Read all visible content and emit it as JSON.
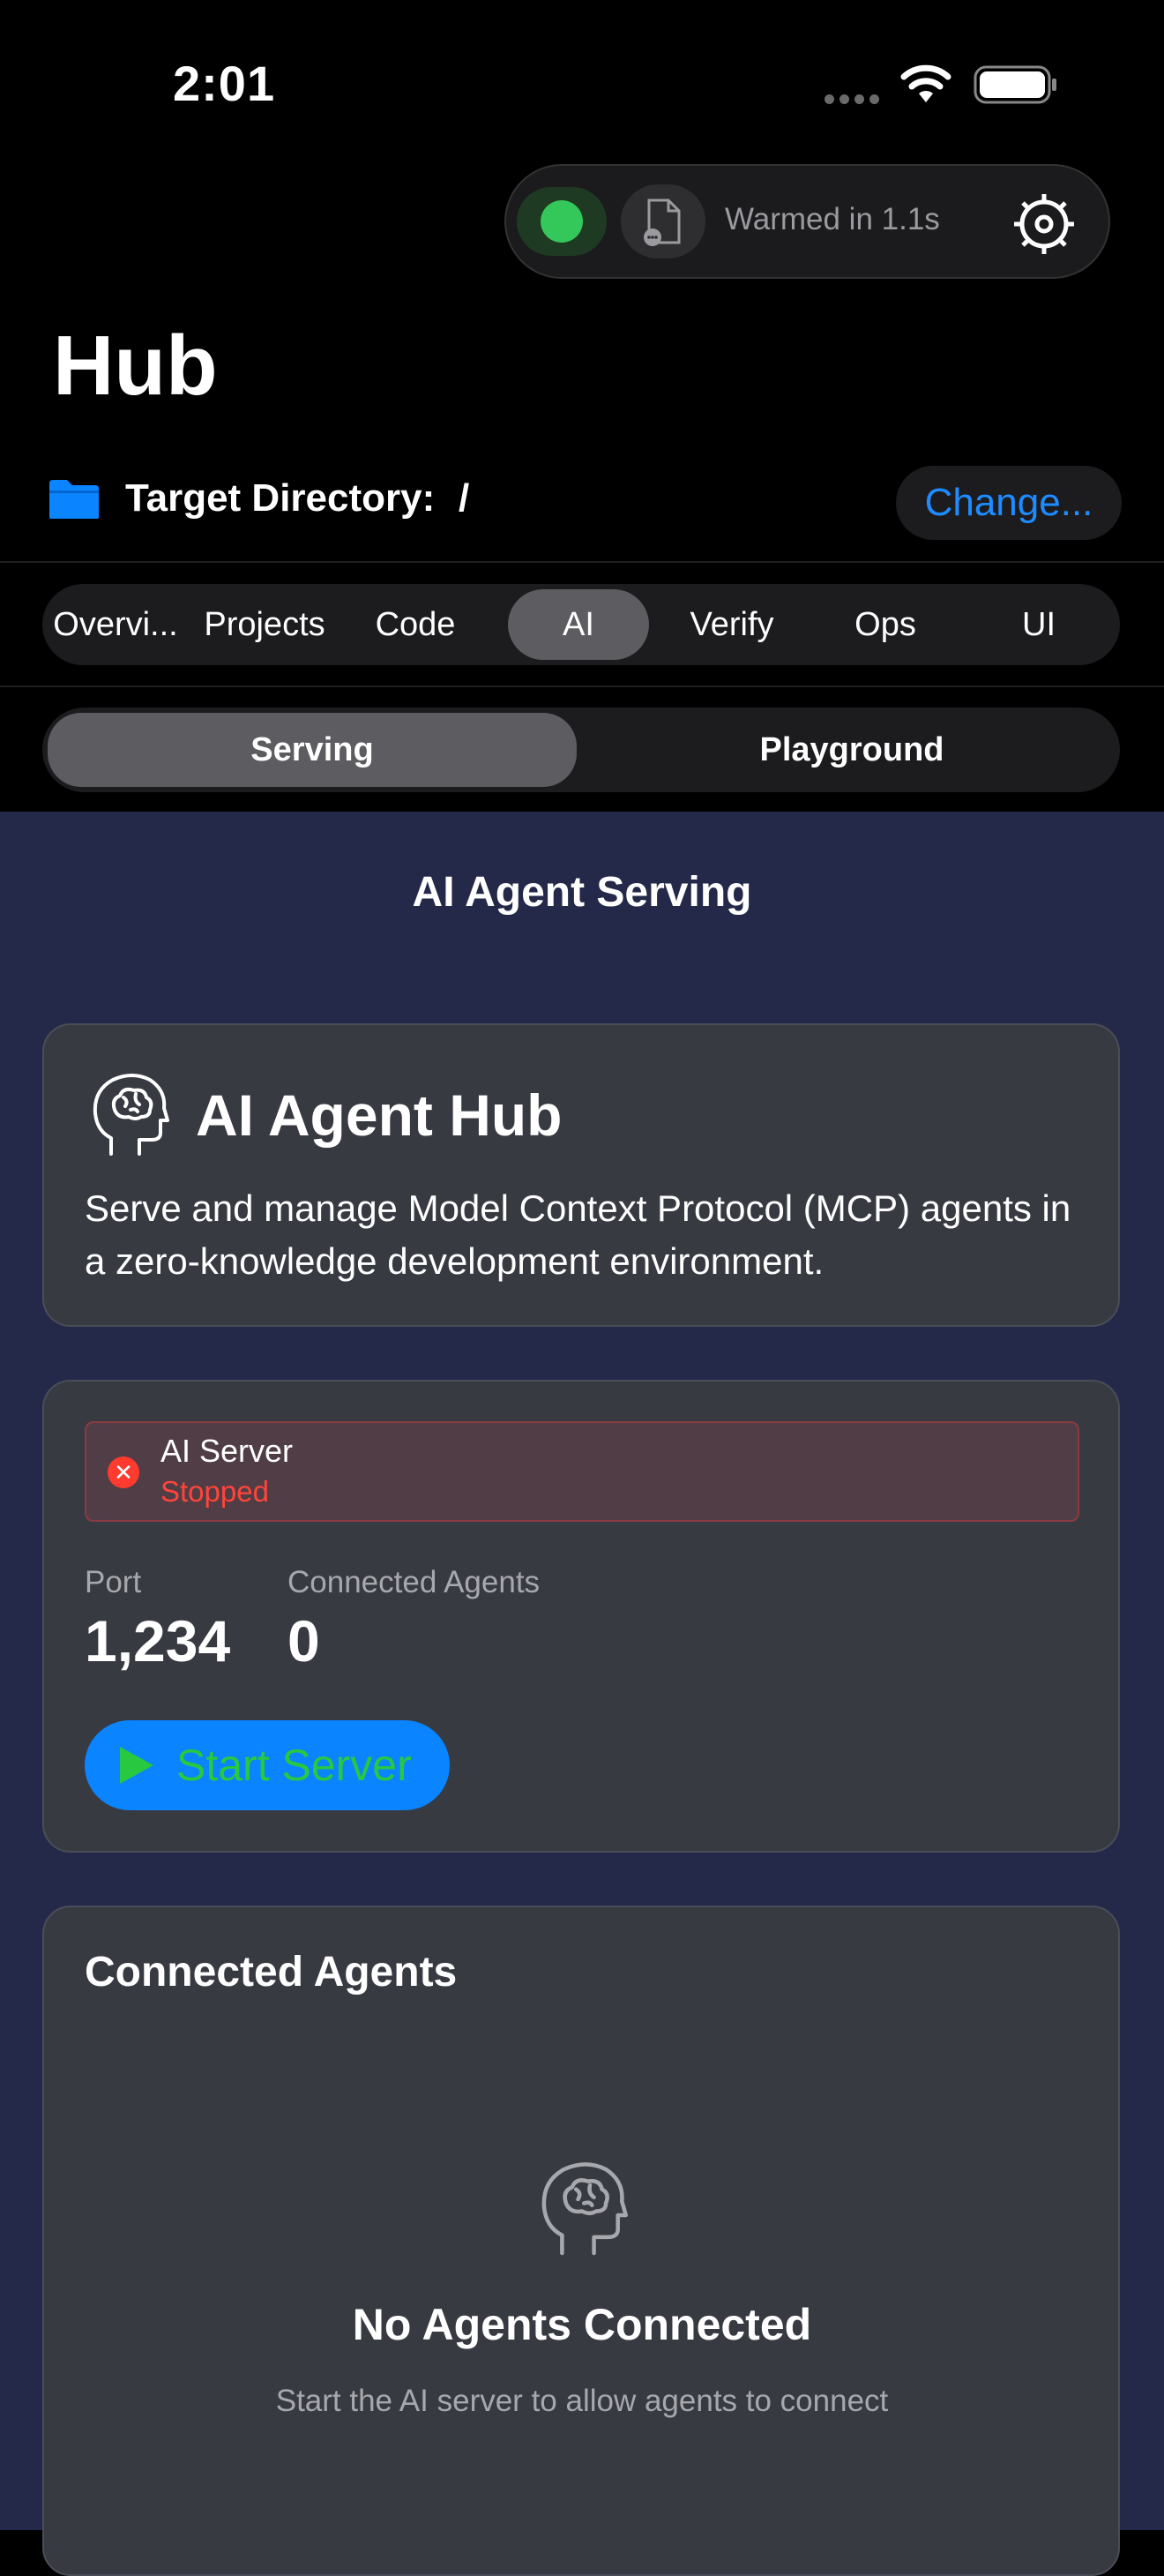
{
  "status_bar": {
    "time": "2:01"
  },
  "top_pill": {
    "warm_text": "Warmed in 1.1s",
    "status_color": "#34c759"
  },
  "header": {
    "title": "Hub"
  },
  "target": {
    "label": "Target Directory:",
    "value": "/",
    "change_label": "Change..."
  },
  "tabs": [
    {
      "label": "Overvi..."
    },
    {
      "label": "Projects"
    },
    {
      "label": "Code"
    },
    {
      "label": "AI",
      "active": true
    },
    {
      "label": "Verify"
    },
    {
      "label": "Ops"
    },
    {
      "label": "UI"
    }
  ],
  "segments": [
    {
      "label": "Serving",
      "active": true
    },
    {
      "label": "Playground"
    }
  ],
  "main": {
    "section_title": "AI Agent Serving",
    "hub_card": {
      "title": "AI Agent Hub",
      "description": "Serve and manage Model Context Protocol (MCP) agents in a zero-knowledge development environment."
    },
    "server_card": {
      "name": "AI Server",
      "state": "Stopped",
      "port_label": "Port",
      "port_value": "1,234",
      "agents_label": "Connected Agents",
      "agents_value": "0",
      "start_label": "Start Server"
    },
    "agents_card": {
      "title": "Connected Agents",
      "empty_title": "No Agents Connected",
      "empty_subtitle": "Start the AI server to allow agents to connect"
    }
  },
  "colors": {
    "accent": "#0a84ff",
    "error": "#ff453a",
    "success": "#28c840",
    "background": "#242949"
  }
}
